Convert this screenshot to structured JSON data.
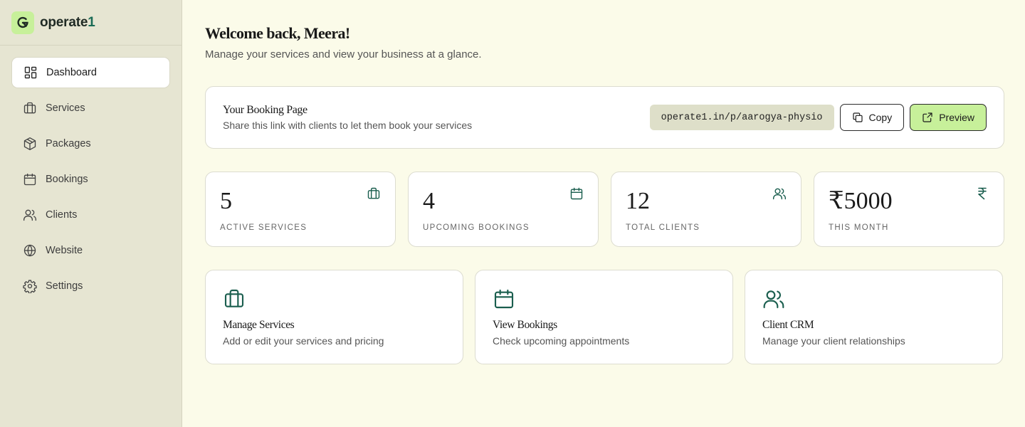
{
  "brand": {
    "name_main": "operate",
    "name_accent": "1",
    "logo_letter": "G"
  },
  "sidebar": {
    "items": [
      {
        "label": "Dashboard",
        "icon": "dashboard-icon"
      },
      {
        "label": "Services",
        "icon": "briefcase-icon"
      },
      {
        "label": "Packages",
        "icon": "package-icon"
      },
      {
        "label": "Bookings",
        "icon": "calendar-icon"
      },
      {
        "label": "Clients",
        "icon": "users-icon"
      },
      {
        "label": "Website",
        "icon": "globe-icon"
      },
      {
        "label": "Settings",
        "icon": "gear-icon"
      }
    ]
  },
  "header": {
    "title": "Welcome back, Meera!",
    "subtitle": "Manage your services and view your business at a glance."
  },
  "booking_page": {
    "title": "Your Booking Page",
    "description": "Share this link with clients to let them book your services",
    "link": "operate1.in/p/aarogya-physio",
    "copy_label": "Copy",
    "preview_label": "Preview"
  },
  "stats": [
    {
      "value": "5",
      "label": "Active Services",
      "icon": "briefcase-icon"
    },
    {
      "value": "4",
      "label": "Upcoming Bookings",
      "icon": "calendar-icon"
    },
    {
      "value": "12",
      "label": "Total Clients",
      "icon": "users-icon"
    },
    {
      "value": "₹5000",
      "label": "This Month",
      "icon": "rupee-icon"
    }
  ],
  "quick_actions": [
    {
      "title": "Manage Services",
      "description": "Add or edit your services and pricing",
      "icon": "briefcase-icon"
    },
    {
      "title": "View Bookings",
      "description": "Check upcoming appointments",
      "icon": "calendar-icon"
    },
    {
      "title": "Client CRM",
      "description": "Manage your client relationships",
      "icon": "users-icon"
    }
  ],
  "colors": {
    "accent_green": "#c7f09a",
    "icon_teal": "#1a5e4e",
    "sidebar_bg": "#e6e5d2",
    "main_bg": "#fbfbe9"
  }
}
